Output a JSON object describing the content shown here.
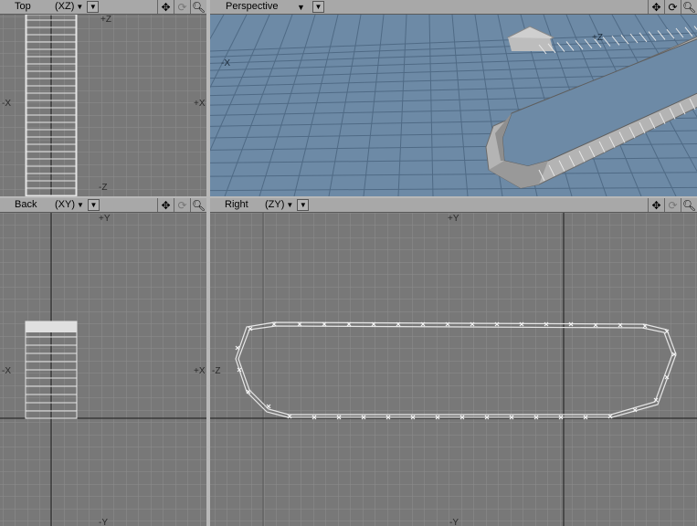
{
  "viewports": {
    "top": {
      "title": "Top",
      "axes": "(XZ)",
      "labels": {
        "pz": "+Z",
        "nz": "-Z",
        "nx": "-X",
        "px": "+X"
      }
    },
    "persp": {
      "title": "Perspective",
      "labels": {
        "nx": "-X",
        "pz": "+Z"
      }
    },
    "back": {
      "title": "Back",
      "axes": "(XY)",
      "labels": {
        "py": "+Y",
        "ny": "-Y",
        "nx": "-X",
        "px": "+X"
      }
    },
    "right": {
      "title": "Right",
      "axes": "(ZY)",
      "labels": {
        "py": "+Y",
        "ny": "-Y",
        "nz": "-Z"
      }
    }
  },
  "icons": [
    "move-view-icon",
    "rotate-view-icon",
    "zoom-view-icon"
  ],
  "colors": {
    "grid_bg": "#787878",
    "grid_line": "#8e8e8e",
    "axis_line": "#1a1a1a",
    "persp_bg": "#6d8aa6",
    "mesh_wire": "#e0e0e0"
  }
}
